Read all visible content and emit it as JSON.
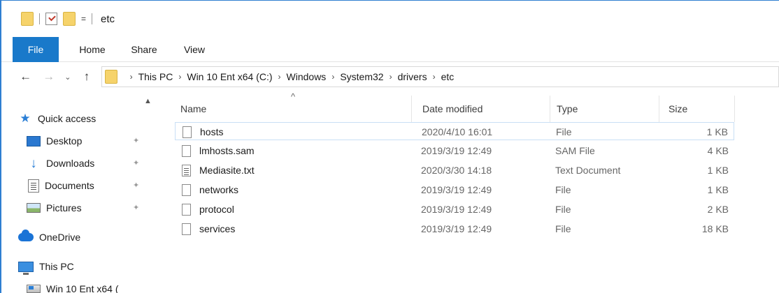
{
  "window": {
    "title": "etc"
  },
  "quick_access_toolbar": {
    "dropdown": "="
  },
  "ribbon": {
    "tabs": [
      {
        "label": "File",
        "active": true
      },
      {
        "label": "Home"
      },
      {
        "label": "Share"
      },
      {
        "label": "View"
      }
    ]
  },
  "navigation": {
    "back": "←",
    "forward": "→",
    "recent": "⌄",
    "up": "↑",
    "breadcrumb": [
      "This PC",
      "Win 10 Ent x64 (C:)",
      "Windows",
      "System32",
      "drivers",
      "etc"
    ],
    "separator": "›"
  },
  "nav_pane": {
    "scroll_up": "▲",
    "items": [
      {
        "label": "Quick access",
        "icon": "star-icon"
      },
      {
        "label": "Desktop",
        "icon": "desktop-icon",
        "pinned": true
      },
      {
        "label": "Downloads",
        "icon": "downloads-icon",
        "pinned": true
      },
      {
        "label": "Documents",
        "icon": "documents-icon",
        "pinned": true
      },
      {
        "label": "Pictures",
        "icon": "pictures-icon",
        "pinned": true
      },
      {
        "label": "OneDrive",
        "icon": "onedrive-icon"
      },
      {
        "label": "This PC",
        "icon": "this-pc-icon"
      },
      {
        "label": "Win 10 Ent x64 (",
        "icon": "drive-icon"
      }
    ],
    "pin_glyph": "✦"
  },
  "file_list": {
    "sort_indicator": "^",
    "columns": {
      "name": "Name",
      "date": "Date modified",
      "type": "Type",
      "size": "Size"
    },
    "rows": [
      {
        "name": "hosts",
        "date": "2020/4/10 16:01",
        "type": "File",
        "size": "1 KB",
        "icon": "file",
        "selected": true
      },
      {
        "name": "lmhosts.sam",
        "date": "2019/3/19 12:49",
        "type": "SAM File",
        "size": "4 KB",
        "icon": "file"
      },
      {
        "name": "Mediasite.txt",
        "date": "2020/3/30 14:18",
        "type": "Text Document",
        "size": "1 KB",
        "icon": "text"
      },
      {
        "name": "networks",
        "date": "2019/3/19 12:49",
        "type": "File",
        "size": "1 KB",
        "icon": "file"
      },
      {
        "name": "protocol",
        "date": "2019/3/19 12:49",
        "type": "File",
        "size": "2 KB",
        "icon": "file"
      },
      {
        "name": "services",
        "date": "2019/3/19 12:49",
        "type": "File",
        "size": "18 KB",
        "icon": "file"
      }
    ]
  },
  "colors": {
    "accent": "#1979ca",
    "folder": "#f6d36b",
    "selection_border": "#c9dff5"
  }
}
